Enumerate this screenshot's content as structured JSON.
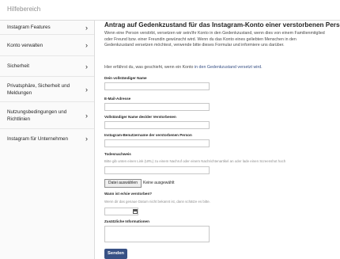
{
  "header": {
    "title": "Hilfebereich"
  },
  "sidebar": {
    "items": [
      {
        "label": "Instagram Features"
      },
      {
        "label": "Konto verwalten"
      },
      {
        "label": "Sicherheit"
      },
      {
        "label": "Privatsphäre, Sicherheit und Meldungen"
      },
      {
        "label": "Nutzungsbedingungen und Richtlinien"
      },
      {
        "label": "Instagram für Unternehmen"
      }
    ],
    "chevron": "›"
  },
  "form": {
    "heading": "Antrag auf Gedenkzustand für das Instagram-Konto einer verstorbenen Person",
    "intro": "Wenn eine Person verstirbt, versetzen wir sein/ihr Konto in den Gedenkzustand, wenn dies von einem Familienmitglied oder Freund bzw. einer Freundin gewünscht wird. Wenn du das Konto eines geliebten Menschen in den Gedenkzustand versetzen möchtest, verwende bitte dieses Formular und informiere uns darüber.",
    "info_prefix": "Hier erfährst du, was geschieht, wenn ein Konto ",
    "info_link": "in den Gedenkzustand versetzt wird.",
    "fields": {
      "full_name": "Dein vollständiger Name",
      "email": "E-Mail-Adresse",
      "deceased_name": "Vollständiger Name des/der Verstorbenen",
      "username": "Instagram-Benutzername der verstorbenen Person",
      "death_proof": "Todesnachweis",
      "death_proof_hint": "Bitte gib unten einen Link (URL) zu einem Nachruf oder einem Nachrichtenartikel an oder lade einen Screenshot hoch",
      "file_button": "Datei auswählen",
      "file_state": "Keine ausgewählt",
      "death_date": "Wann ist er/sie verstorben?",
      "death_date_hint": "Wenn dir das genaue Datum nicht bekannt ist, dann schätze es bitte.",
      "additional": "Zusätzliche Informationen"
    },
    "submit_label": "Senden"
  }
}
